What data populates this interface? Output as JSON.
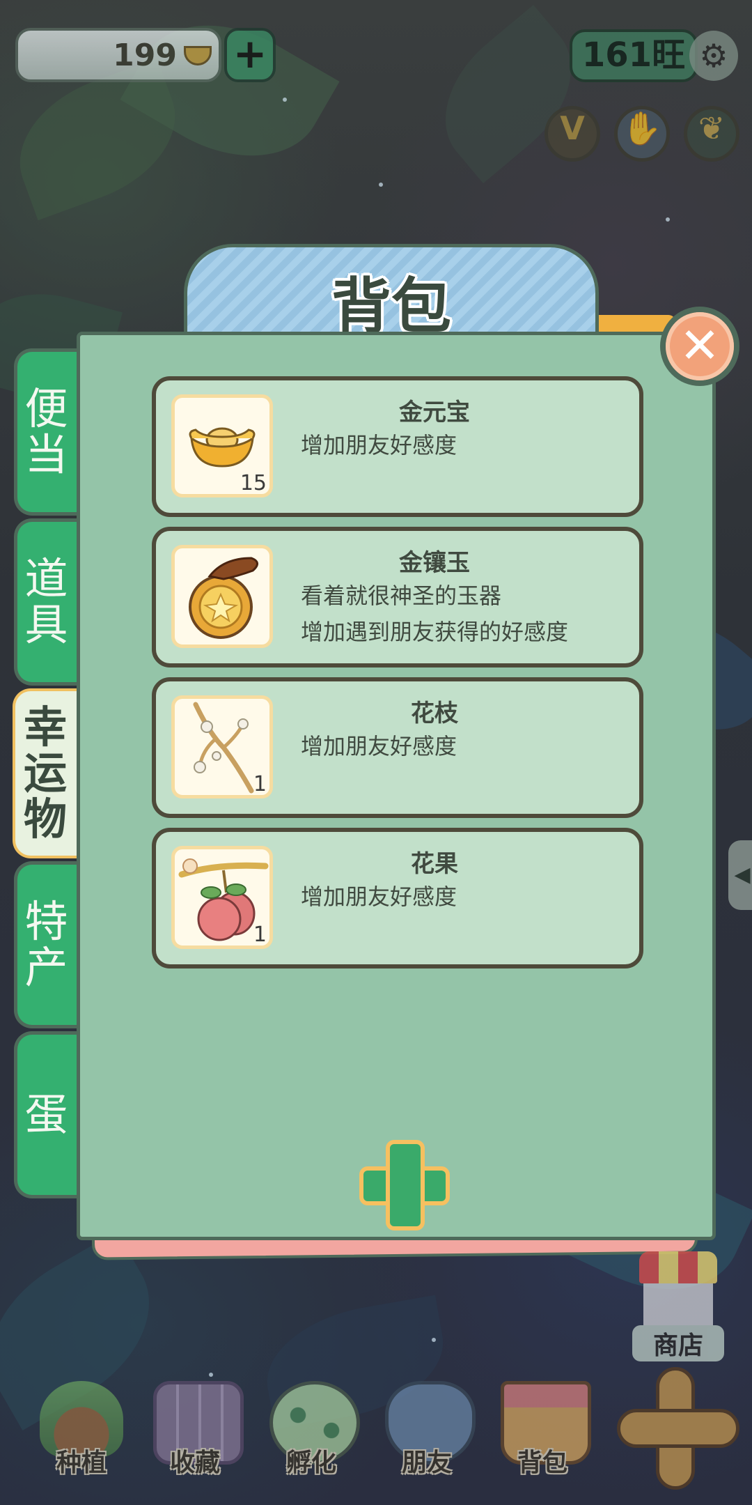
{
  "top_bar": {
    "currency_value": "199",
    "add_label": "+",
    "wang_value": "161旺",
    "settings_icon": "gear-icon",
    "round_buttons": [
      {
        "name": "vip-button",
        "glyph": "V",
        "color": "#b89a40"
      },
      {
        "name": "hand-button",
        "glyph": "✋",
        "color": "#7aa8c0"
      },
      {
        "name": "ginkgo-button",
        "glyph": "❦",
        "color": "#c8a850"
      }
    ]
  },
  "dialog": {
    "title": "背包",
    "close_label": "✕",
    "tabs": [
      {
        "label": [
          "便",
          "当"
        ],
        "active": false
      },
      {
        "label": [
          "道",
          "具"
        ],
        "active": false
      },
      {
        "label": [
          "幸",
          "运",
          "物"
        ],
        "active": true
      },
      {
        "label": [
          "特",
          "产"
        ],
        "active": false
      },
      {
        "label": [
          "蛋"
        ],
        "active": false
      }
    ],
    "items": [
      {
        "name": "金元宝",
        "desc": [
          "增加朋友好感度"
        ],
        "qty": "15",
        "icon": "gold-ingot-icon"
      },
      {
        "name": "金镶玉",
        "desc": [
          "看着就很神圣的玉器",
          "增加遇到朋友获得的好感度"
        ],
        "qty": "",
        "icon": "gold-jade-amulet-icon"
      },
      {
        "name": "花枝",
        "desc": [
          "增加朋友好感度"
        ],
        "qty": "1",
        "icon": "flower-branch-icon"
      },
      {
        "name": "花果",
        "desc": [
          "增加朋友好感度"
        ],
        "qty": "1",
        "icon": "peach-fruit-icon"
      }
    ],
    "add_button_icon": "plus-icon"
  },
  "side": {
    "shop_label": "商店",
    "expand_arrow": "◀"
  },
  "bottom_nav": [
    {
      "label": "种植",
      "icon": "planting-icon"
    },
    {
      "label": "收藏",
      "icon": "collection-book-icon"
    },
    {
      "label": "孵化",
      "icon": "egg-hatch-icon"
    },
    {
      "label": "朋友",
      "icon": "cat-friend-icon"
    },
    {
      "label": "背包",
      "icon": "backpack-basket-icon"
    }
  ],
  "colors": {
    "panel": "#94c4a8",
    "card": "#c2e0ca",
    "tab_green": "#34b070",
    "title_blue": "#a8d0ea",
    "close_orange": "#f2a27a"
  }
}
